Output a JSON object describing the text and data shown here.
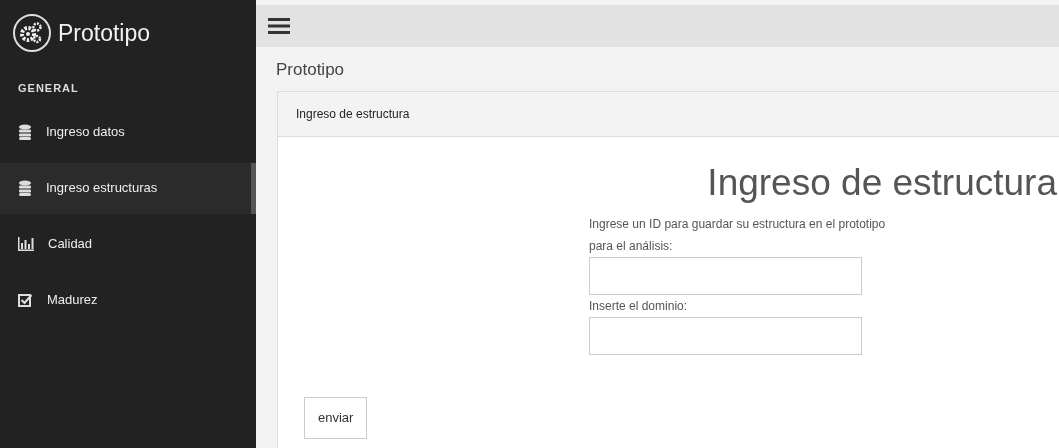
{
  "brand": {
    "title": "Prototipo"
  },
  "sidebar": {
    "section": "GENERAL",
    "items": [
      {
        "label": "Ingreso datos",
        "kind": "database",
        "selected": false
      },
      {
        "label": "Ingreso estructuras",
        "kind": "database",
        "selected": true
      },
      {
        "label": "Calidad",
        "kind": "chart",
        "selected": false
      },
      {
        "label": "Madurez",
        "kind": "check",
        "selected": false
      }
    ]
  },
  "page_title": "Prototipo",
  "card": {
    "header": "Ingreso de estructura",
    "heading": "Ingreso de estructura",
    "fields": [
      {
        "label": "Ingrese un ID para guardar su estructura en el prototipo para el análisis:"
      },
      {
        "label": "Inserte el dominio:"
      }
    ],
    "button": "enviar"
  }
}
